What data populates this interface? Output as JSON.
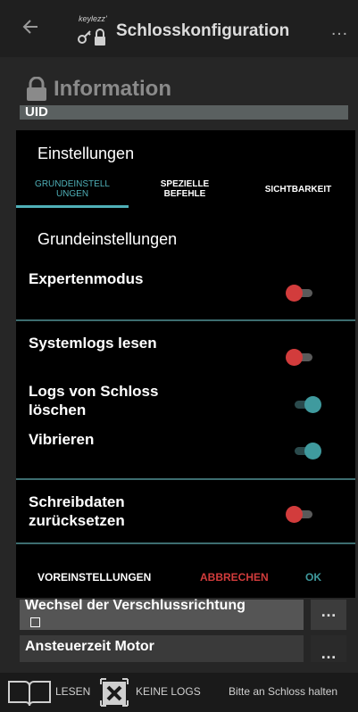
{
  "appbar": {
    "brand": "keylezz'",
    "title": "Schlosskonfiguration",
    "back_icon": "arrow-left-icon",
    "more_label": "…"
  },
  "background": {
    "info_title": "Information",
    "uid_label": "UID",
    "row1_label": "Wechsel der Verschlussrichtung",
    "row2_label": "Ansteuerzeit Motor",
    "dots_label": "…"
  },
  "dialog": {
    "title": "Einstellungen",
    "tabs": [
      {
        "label": "GRUNDEINSTELL UNGEN",
        "active": true
      },
      {
        "label": "SPEZIELLE BEFEHLE",
        "active": false
      },
      {
        "label": "SICHTBARKEIT",
        "active": false
      }
    ],
    "section_title": "Grundeinstellungen",
    "settings": [
      {
        "label": "Expertenmodus",
        "on": false
      },
      {
        "label": "Systemlogs lesen",
        "on": false
      },
      {
        "label": "Logs von Schloss löschen",
        "on": true
      },
      {
        "label": "Vibrieren",
        "on": true
      },
      {
        "label": "Schreibdaten zurücksetzen",
        "on": false
      }
    ],
    "actions": {
      "defaults": "VOREINSTELLUNGEN",
      "cancel": "ABBRECHEN",
      "ok": "OK"
    }
  },
  "bottombar": {
    "read_label": "LESEN",
    "nologs_label": "KEINE LOGS",
    "status_label": "Bitte an Schloss halten"
  },
  "colors": {
    "accent": "#3f9a9e",
    "danger": "#d23c3c"
  }
}
